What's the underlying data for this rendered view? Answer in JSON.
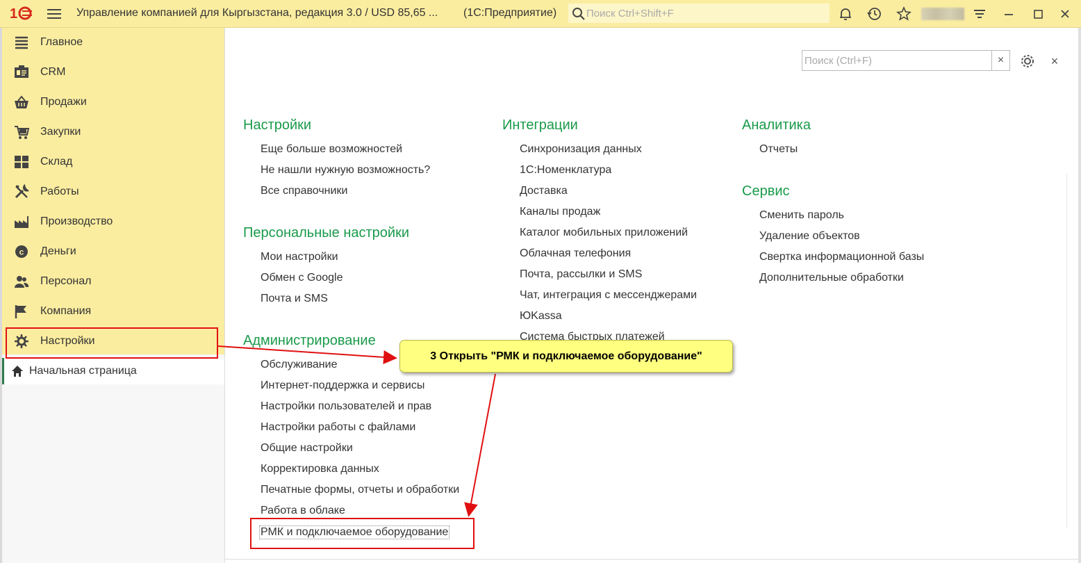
{
  "titlebar": {
    "app_title": "Управление компанией для Кыргызстана, редакция 3.0 / USD 85,65 ...",
    "app_platform": "(1С:Предприятие)",
    "search_placeholder": "Поиск Ctrl+Shift+F"
  },
  "sidebar": {
    "items": [
      {
        "label": "Главное",
        "icon": "menu-lines-icon"
      },
      {
        "label": "CRM",
        "icon": "crm-card-icon"
      },
      {
        "label": "Продажи",
        "icon": "basket-icon"
      },
      {
        "label": "Закупки",
        "icon": "cart-icon"
      },
      {
        "label": "Склад",
        "icon": "warehouse-grid-icon"
      },
      {
        "label": "Работы",
        "icon": "tools-icon"
      },
      {
        "label": "Производство",
        "icon": "factory-icon"
      },
      {
        "label": "Деньги",
        "icon": "coin-icon"
      },
      {
        "label": "Персонал",
        "icon": "people-icon"
      },
      {
        "label": "Компания",
        "icon": "flag-icon"
      },
      {
        "label": "Настройки",
        "icon": "gear-icon"
      }
    ],
    "start_page": "Начальная страница"
  },
  "content": {
    "search_placeholder": "Поиск (Ctrl+F)",
    "sections": {
      "nastroiki": {
        "title": "Настройки",
        "links": [
          "Еще больше возможностей",
          "Не нашли нужную возможность?",
          "Все справочники"
        ]
      },
      "personal": {
        "title": "Персональные настройки",
        "links": [
          "Мои настройки",
          "Обмен с Google",
          "Почта и SMS"
        ]
      },
      "admin": {
        "title": "Администрирование",
        "links": [
          "Обслуживание",
          "Интернет-поддержка и сервисы",
          "Настройки пользователей и прав",
          "Настройки работы с файлами",
          "Общие настройки",
          "Корректировка данных",
          "Печатные формы, отчеты и обработки",
          "Работа в облаке",
          "РМК и подключаемое оборудование"
        ]
      },
      "integr": {
        "title": "Интеграции",
        "links": [
          "Синхронизация данных",
          "1С:Номенклатура",
          "Доставка",
          "Каналы продаж",
          "Каталог мобильных приложений",
          "Облачная телефония",
          "Почта, рассылки и SMS",
          "Чат, интеграция с мессенджерами",
          "ЮKassa",
          "Система быстрых платежей"
        ]
      },
      "analytics": {
        "title": "Аналитика",
        "links": [
          "Отчеты"
        ]
      },
      "service": {
        "title": "Сервис",
        "links": [
          "Сменить пароль",
          "Удаление объектов",
          "Свертка информационной базы",
          "Дополнительные обработки"
        ]
      }
    }
  },
  "annotation": {
    "callout_text": "3 Открыть \"РМК и подключаемое оборудование\""
  },
  "colors": {
    "sidebar_bg": "#fbeda0",
    "section_title": "#1a9a4a",
    "highlight_red": "#e01010",
    "callout_bg": "#ffff80"
  }
}
